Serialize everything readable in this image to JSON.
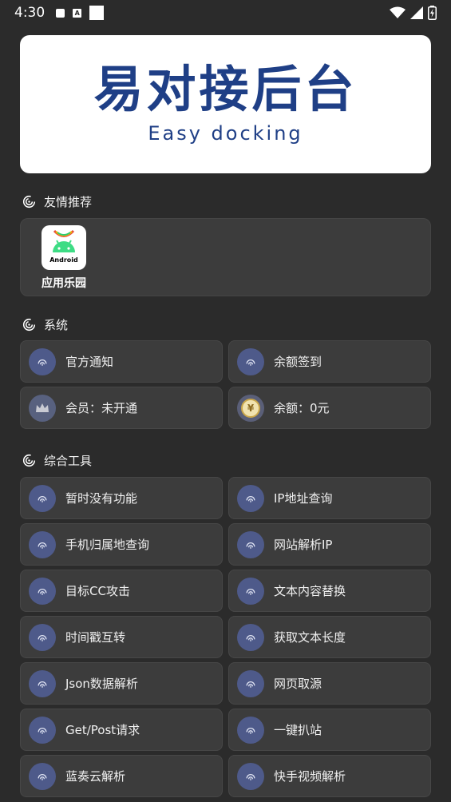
{
  "status_bar": {
    "time": "4:30",
    "a_glyph": "A"
  },
  "banner": {
    "title": "易对接后台",
    "subtitle": "Easy docking"
  },
  "sections": {
    "friends": "友情推荐",
    "system": "系统",
    "tools": "综合工具"
  },
  "friends": {
    "apps": [
      {
        "label": "应用乐园",
        "icon_text": "Android"
      }
    ]
  },
  "system_tiles": [
    {
      "label": "官方通知",
      "icon": "fingerprint-icon"
    },
    {
      "label": "余额签到",
      "icon": "fingerprint-icon"
    },
    {
      "label": "会员：未开通",
      "icon": "crown-icon"
    },
    {
      "label": "余额：0元",
      "icon": "coin-icon",
      "coin_glyph": "¥"
    }
  ],
  "tool_tiles": [
    {
      "label": "暂时没有功能"
    },
    {
      "label": "IP地址查询"
    },
    {
      "label": "手机归属地查询"
    },
    {
      "label": "网站解析IP"
    },
    {
      "label": "目标CC攻击"
    },
    {
      "label": "文本内容替换"
    },
    {
      "label": "时间戳互转"
    },
    {
      "label": "获取文本长度"
    },
    {
      "label": "Json数据解析"
    },
    {
      "label": "网页取源"
    },
    {
      "label": "Get/Post请求"
    },
    {
      "label": "一键扒站"
    },
    {
      "label": "蓝奏云解析"
    },
    {
      "label": "快手视频解析"
    }
  ],
  "colors": {
    "background": "#2b2b2b",
    "tile": "#3c3c3c",
    "icon_circle": "#4e5a8a",
    "brand_blue": "#1f3f86"
  }
}
